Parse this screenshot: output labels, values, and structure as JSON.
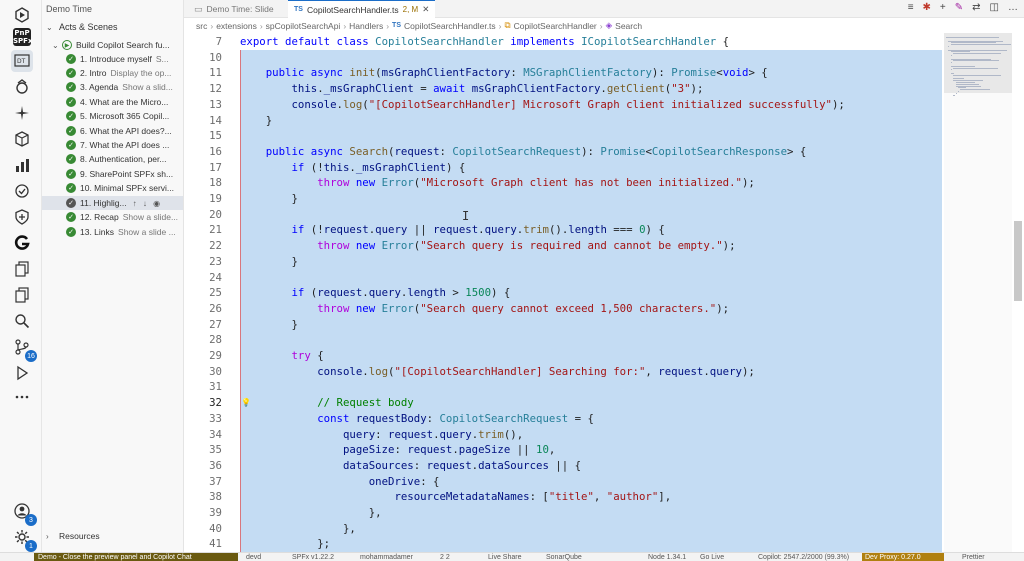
{
  "activity_bar": {
    "badge_testing": "16",
    "badge_accounts": "3",
    "badge_settings": "1"
  },
  "sidebar": {
    "title": "Demo Time",
    "section": "Acts & Scenes",
    "demo_group": "Build Copilot Search fu...",
    "items": [
      {
        "label": "1. Introduce myself",
        "desc": "S..."
      },
      {
        "label": "2. Intro",
        "desc": "Display the op..."
      },
      {
        "label": "3. Agenda",
        "desc": "Show a slid..."
      },
      {
        "label": "4. What are the Micro...",
        "desc": ""
      },
      {
        "label": "5. Microsoft 365 Copil...",
        "desc": ""
      },
      {
        "label": "6. What the API does?...",
        "desc": ""
      },
      {
        "label": "7. What the API does ...",
        "desc": ""
      },
      {
        "label": "8. Authentication, per...",
        "desc": ""
      },
      {
        "label": "9. SharePoint SPFx sh...",
        "desc": ""
      },
      {
        "label": "10. Minimal SPFx servi...",
        "desc": ""
      },
      {
        "label": "11. Highlig...",
        "desc": ""
      },
      {
        "label": "12. Recap",
        "desc": "Show a slide..."
      },
      {
        "label": "13. Links",
        "desc": "Show a slide ..."
      }
    ],
    "footer": "Resources"
  },
  "tabs": [
    {
      "label": "Demo Time: Slide"
    },
    {
      "label": "CopilotSearchHandler.ts",
      "modified": "2, M"
    }
  ],
  "breadcrumb": [
    "src",
    "extensions",
    "spCopilotSearchApi",
    "Handlers",
    "CopilotSearchHandler.ts",
    "CopilotSearchHandler",
    "Search"
  ],
  "editor": {
    "line_numbers": [
      "7",
      "10",
      "11",
      "12",
      "13",
      "14",
      "15",
      "16",
      "17",
      "18",
      "19",
      "20",
      "21",
      "22",
      "23",
      "24",
      "25",
      "26",
      "27",
      "28",
      "29",
      "30",
      "31",
      "32",
      "33",
      "34",
      "35",
      "36",
      "37",
      "38",
      "39",
      "40",
      "41"
    ],
    "lines": [
      "export default class CopilotSearchHandler implements ICopilotSearchHandler {",
      "",
      "    public async init(msGraphClientFactory: MSGraphClientFactory): Promise<void> {",
      "        this._msGraphClient = await msGraphClientFactory.getClient(\"3\");",
      "        console.log(\"[CopilotSearchHandler] Microsoft Graph client initialized successfully\");",
      "    }",
      "",
      "    public async Search(request: CopilotSearchRequest): Promise<CopilotSearchResponse> {",
      "        if (!this._msGraphClient) {",
      "            throw new Error(\"Microsoft Graph client has not been initialized.\");",
      "        }",
      "",
      "        if (!request.query || request.query.trim().length === 0) {",
      "            throw new Error(\"Search query is required and cannot be empty.\");",
      "        }",
      "",
      "        if (request.query.length > 1500) {",
      "            throw new Error(\"Search query cannot exceed 1,500 characters.\");",
      "        }",
      "",
      "        try {",
      "            console.log(\"[CopilotSearchHandler] Searching for:\", request.query);",
      "",
      "            // Request body",
      "            const requestBody: CopilotSearchRequest = {",
      "                query: request.query.trim(),",
      "                pageSize: request.pageSize || 10,",
      "                dataSources: request.dataSources || {",
      "                    oneDrive: {",
      "                        resourceMetadataNames: [\"title\", \"author\"],",
      "                    },",
      "                },",
      "            };"
    ]
  },
  "status_bar": {
    "remote": "Demo - Close the preview panel and Copilot Chat",
    "items": [
      "devd",
      "SPFx v1.22.2",
      "mohammadamer",
      "2  2",
      "Live Share",
      "SonarQube",
      "Node 1.34.1",
      "Go Live",
      "Copilot: 2547.2/2000 (99.3%)"
    ],
    "warning": "Dev Proxy: 0.27.0",
    "prettier": "Prettier"
  }
}
